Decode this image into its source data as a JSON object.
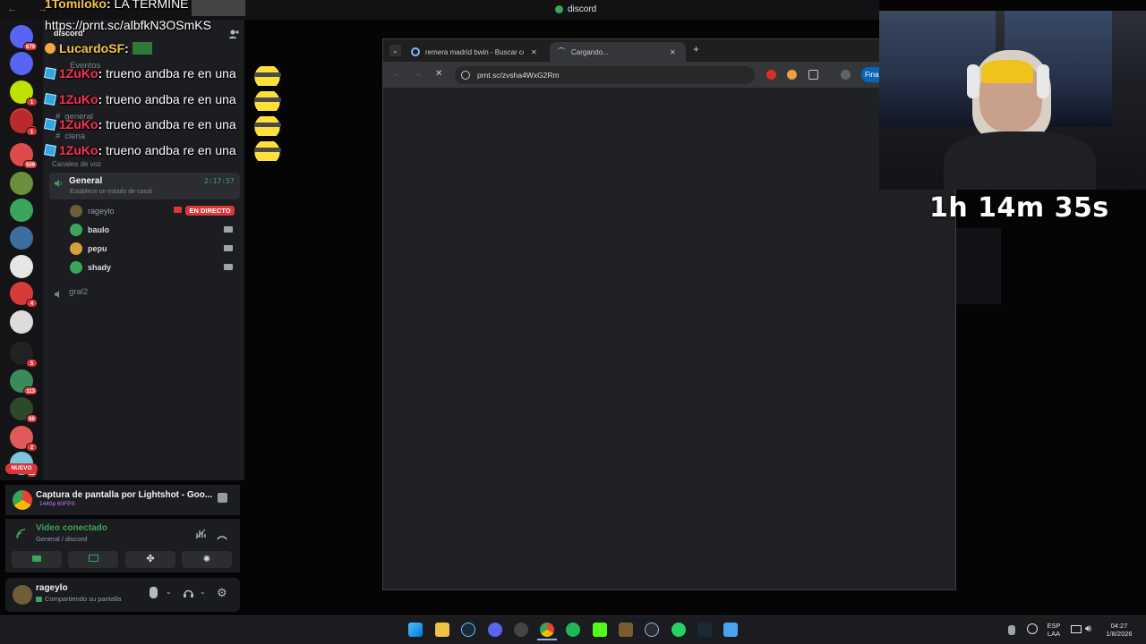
{
  "discord": {
    "window_title": "discord",
    "nav_arrows": "← →",
    "server_name": "discord",
    "events_label": "Eventos",
    "text_channels": [
      "general",
      "clena"
    ],
    "voice_category": "Canales de voz",
    "voice_channel": {
      "name": "General",
      "timer": "2:17:57",
      "status_hint": "Establece un estado de canal"
    },
    "members": [
      {
        "name": "rageylo",
        "live": "EN DIRECTO",
        "color": "#6f5d3a"
      },
      {
        "name": "baulo",
        "color": "#3ba55c"
      },
      {
        "name": "pepu",
        "color": "#d6a03a"
      },
      {
        "name": "shady",
        "color": "#3ba55c"
      }
    ],
    "voice_channel_2": "gral2",
    "new_badge": "NUEVO",
    "server_badges": [
      "679",
      "",
      "1",
      "1",
      "1",
      "509",
      "",
      "",
      "",
      "",
      "4",
      "",
      "5",
      "113",
      "86",
      "2",
      "13"
    ],
    "stream": {
      "title": "Captura de pantalla por Lightshot - Goo...",
      "quality": "1440p 60FPS"
    },
    "voice_status": {
      "title": "Video conectado",
      "subtitle": "General / discord"
    },
    "user": {
      "name": "rageylo",
      "status": "Compartiendo su pantalla"
    }
  },
  "chat_overlay": [
    {
      "name": "1Tomiloko",
      "message": "LA TERMINE",
      "name_color": "#f4c542"
    },
    {
      "name": "",
      "message": "https://prnt.sc/albfkN3OSmKS",
      "name_color": "#ffffff"
    },
    {
      "name": "LucardoSF",
      "message": "",
      "name_color": "#f4c542"
    },
    {
      "name": "1ZuKo",
      "message": "trueno andba re en una"
    },
    {
      "name": "1ZuKo",
      "message": "trueno andba re en una"
    },
    {
      "name": "1ZuKo",
      "message": "trueno andba re en una"
    },
    {
      "name": "1ZuKo",
      "message": "trueno andba re en una"
    }
  ],
  "browser": {
    "tabs": [
      {
        "label": "remera madrid bwin - Buscar co"
      },
      {
        "label": "Cargando..."
      }
    ],
    "url": "prnt.sc/zvsha4WxG2Rm",
    "new_tab": "+",
    "extension_label": "Fina"
  },
  "stream_timer": "1h 14m 35s",
  "taskbar": {
    "lang": "ESP",
    "layout": "LAA",
    "time": "04:27",
    "date": "1/8/2026"
  },
  "colors": {
    "discord_bg": "#1c1d21",
    "accent_green": "#3ba55c",
    "live_red": "#da373c",
    "browser_bg": "#202124"
  }
}
